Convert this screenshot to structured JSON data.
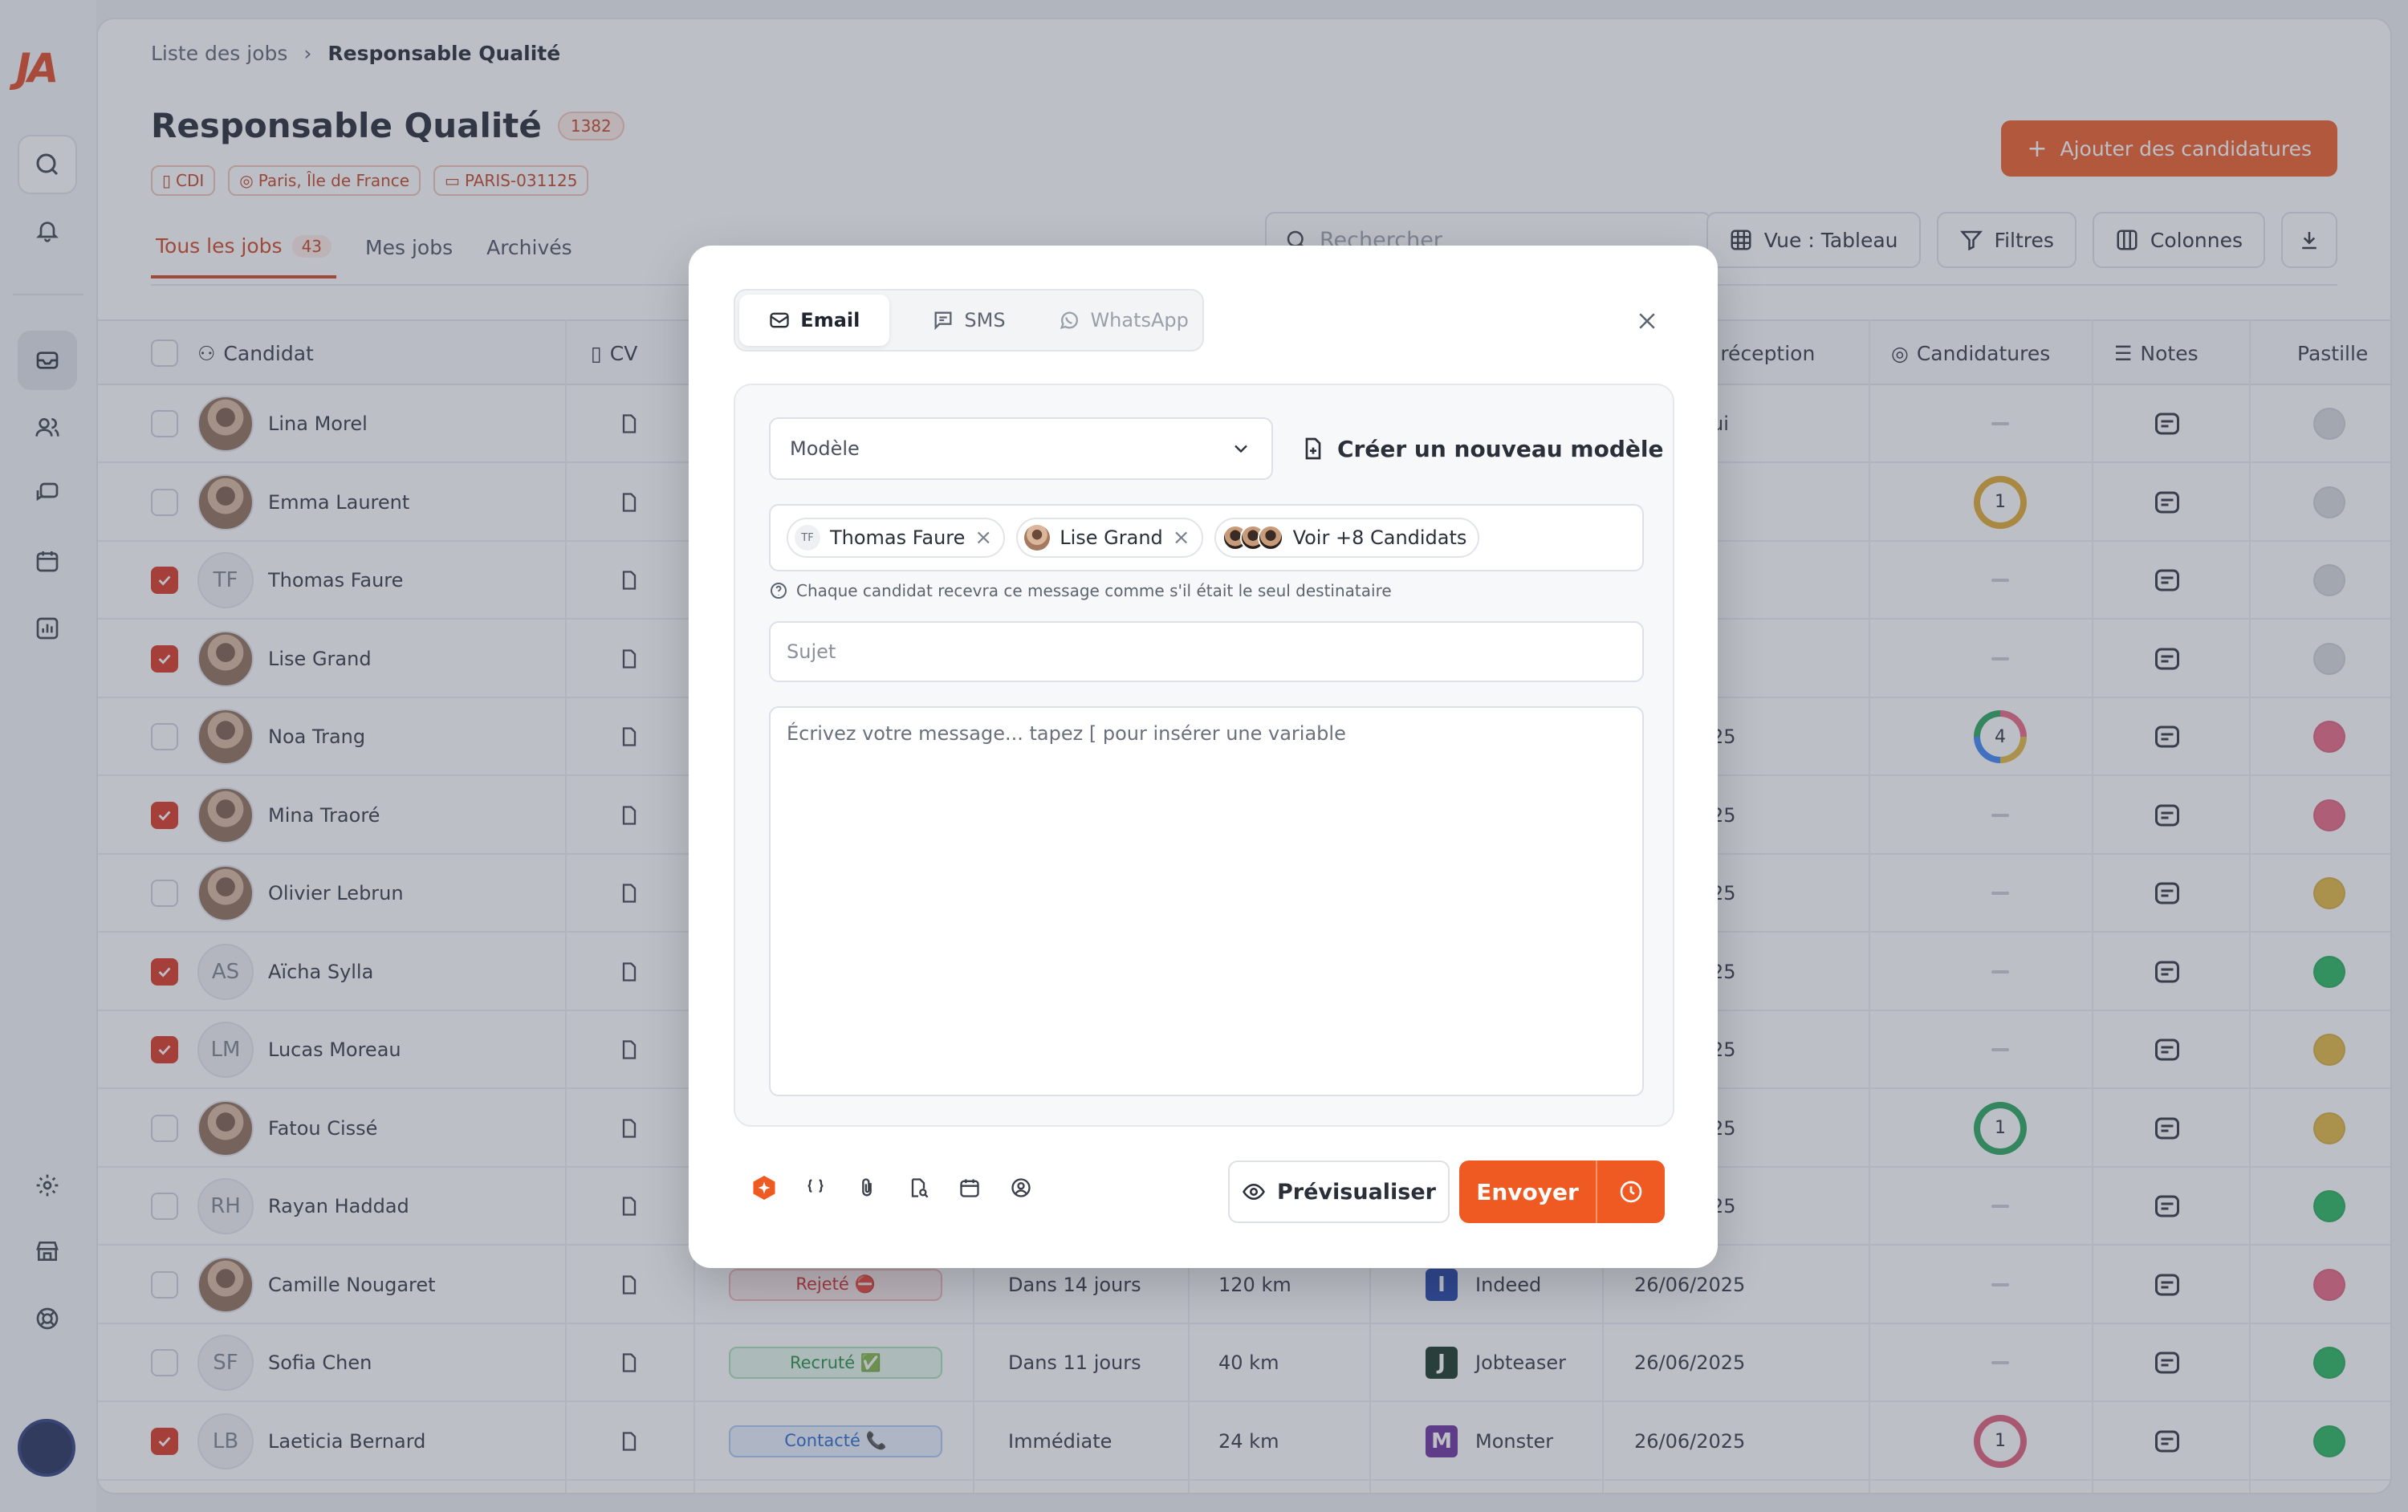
{
  "app": {
    "logo": "JA"
  },
  "breadcrumb": {
    "parent": "Liste des jobs",
    "current": "Responsable Qualité"
  },
  "job": {
    "title": "Responsable Qualité",
    "count": "1382",
    "tags": [
      "CDI",
      "Paris, Île de France",
      "PARIS-031125"
    ]
  },
  "tabs": [
    {
      "label": "Tous les jobs",
      "count": "43"
    },
    {
      "label": "Mes jobs"
    },
    {
      "label": "Archivés"
    }
  ],
  "actions": {
    "add": "Ajouter des candidatures",
    "search_placeholder": "Rechercher",
    "view": "Vue : Tableau",
    "filters": "Filtres",
    "columns": "Colonnes"
  },
  "table": {
    "headers": {
      "candidate": "Candidat",
      "cv": "CV",
      "reception": "e réception",
      "applications": "Candidatures",
      "notes": "Notes",
      "badge": "Pastille"
    },
    "rows": [
      {
        "name": "Lina Morel",
        "checked": false,
        "initials": "",
        "reception": "ui",
        "apps": "",
        "appsColor": "",
        "dot": "#d6d8dc"
      },
      {
        "name": "Emma Laurent",
        "checked": false,
        "initials": "",
        "reception": "",
        "apps": "1",
        "appsColor": "#e0a72a",
        "dot": "#d6d8dc"
      },
      {
        "name": "Thomas Faure",
        "checked": true,
        "initials": "TF",
        "reception": "",
        "apps": "",
        "appsColor": "",
        "dot": "#d6d8dc"
      },
      {
        "name": "Lise Grand",
        "checked": true,
        "initials": "",
        "reception": "",
        "apps": "",
        "appsColor": "",
        "dot": "#d6d8dc"
      },
      {
        "name": "Noa Trang",
        "checked": false,
        "initials": "",
        "reception": "25",
        "apps": "4",
        "appsColor": "multi",
        "dot": "#e8637e"
      },
      {
        "name": "Mina Traoré",
        "checked": true,
        "initials": "",
        "reception": "25",
        "apps": "",
        "appsColor": "",
        "dot": "#e8637e"
      },
      {
        "name": "Olivier Lebrun",
        "checked": false,
        "initials": "",
        "reception": "25",
        "apps": "",
        "appsColor": "",
        "dot": "#e2b53b"
      },
      {
        "name": "Aïcha Sylla",
        "checked": true,
        "initials": "AS",
        "reception": "25",
        "apps": "",
        "appsColor": "",
        "dot": "#22b35a"
      },
      {
        "name": "Lucas Moreau",
        "checked": true,
        "initials": "LM",
        "reception": "25",
        "apps": "",
        "appsColor": "",
        "dot": "#e2b53b"
      },
      {
        "name": "Fatou Cissé",
        "checked": false,
        "initials": "",
        "reception": "25",
        "apps": "1",
        "appsColor": "#22a356",
        "dot": "#e2b53b"
      },
      {
        "name": "Rayan Haddad",
        "checked": false,
        "initials": "RH",
        "reception": "25",
        "apps": "",
        "appsColor": "",
        "dot": "#22b35a"
      },
      {
        "name": "Camille Nougaret",
        "checked": false,
        "initials": "",
        "status": "Rejeté ⛔",
        "statusType": "rejected",
        "availability": "Dans 14 jours",
        "distance": "120 km",
        "source": "Indeed",
        "sourceColor": "#1c3fa8",
        "reception": "26/06/2025",
        "apps": "",
        "appsColor": "",
        "dot": "#e8637e"
      },
      {
        "name": "Sofia Chen",
        "checked": false,
        "initials": "SF",
        "status": "Recruté ✅",
        "statusType": "hired",
        "availability": "Dans 11 jours",
        "distance": "40 km",
        "source": "Jobteaser",
        "sourceColor": "#12311f",
        "reception": "26/06/2025",
        "apps": "",
        "appsColor": "",
        "dot": "#22b35a"
      },
      {
        "name": "Laeticia Bernard",
        "checked": true,
        "initials": "LB",
        "status": "Contacté 📞",
        "statusType": "contacted",
        "availability": "Immédiate",
        "distance": "24 km",
        "source": "Monster",
        "sourceColor": "#6a2c9c",
        "reception": "26/06/2025",
        "apps": "1",
        "appsColor": "#e05a78",
        "dot": "#22b35a"
      }
    ]
  },
  "modal": {
    "tabs": {
      "email": "Email",
      "sms": "SMS",
      "whatsapp": "WhatsApp"
    },
    "template_placeholder": "Modèle",
    "new_template": "Créer un nouveau modèle",
    "recipients": [
      {
        "initials": "TF",
        "name": "Thomas Faure"
      },
      {
        "initials": "",
        "name": "Lise Grand"
      }
    ],
    "more_recipients": "Voir +8 Candidats",
    "hint": "Chaque candidat recevra ce message comme s'il était le seul destinataire",
    "subject_placeholder": "Sujet",
    "body_placeholder": "Écrivez votre message... tapez [ pour insérer une variable",
    "preview": "Prévisualiser",
    "send": "Envoyer"
  }
}
